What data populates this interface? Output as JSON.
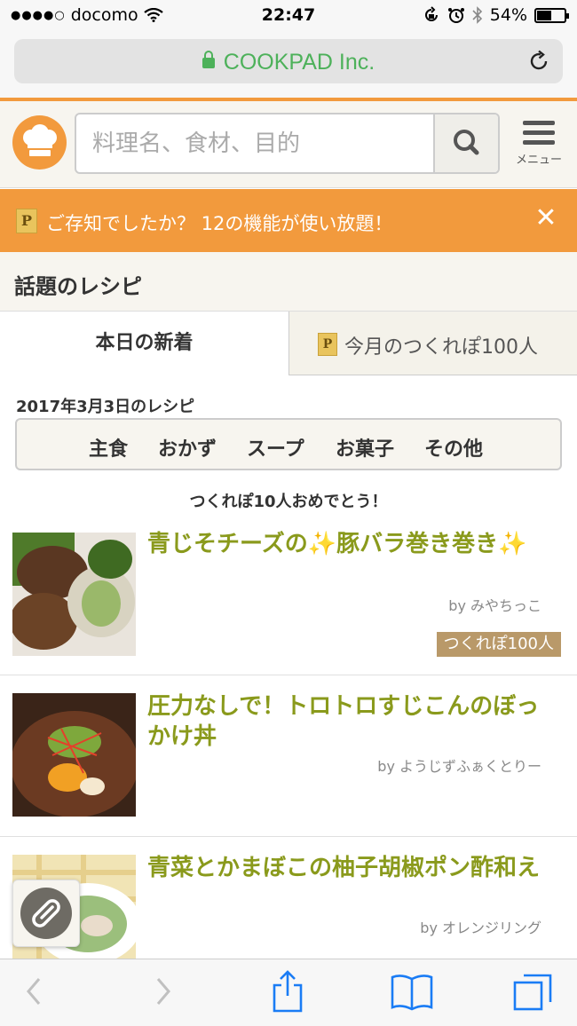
{
  "status_bar": {
    "signal": "●●●●○",
    "carrier": "docomo",
    "time": "22:47",
    "battery_percent": "54%",
    "battery_level": 0.54
  },
  "browser": {
    "url": "COOKPAD Inc."
  },
  "header": {
    "search_placeholder": "料理名、食材、目的",
    "menu_label": "メニュー"
  },
  "notice": {
    "badge": "P",
    "text": "ご存知でしたか？ 12の機能が使い放題！",
    "close": "✕"
  },
  "section": {
    "title": "話題のレシピ"
  },
  "tabs": [
    {
      "label": "本日の新着",
      "active": true
    },
    {
      "label": "今月のつくれぽ100人",
      "badge": "P",
      "active": false
    }
  ],
  "date_label": "2017年3月3日のレシピ",
  "categories": [
    "主食",
    "おかず",
    "スープ",
    "お菓子",
    "その他"
  ],
  "congrats": "つくれぽ10人おめでとう！",
  "recipes": [
    {
      "title": "青じそチーズの✨豚バラ巻き巻き✨",
      "author": "by みやちっこ",
      "badge": "つくれぽ100人"
    },
    {
      "title": "圧力なしで！トロトロすじこんのぼっかけ丼",
      "author": "by ようじずふぁくとりー"
    },
    {
      "title": "青菜とかまぼこの柚子胡椒ポン酢和え",
      "author": "by オレンジリング"
    }
  ],
  "colors": {
    "accent_orange": "#f29a3d",
    "recipe_title_green": "#8a9a1c",
    "url_green": "#4db15a",
    "ios_blue": "#1a7cf5"
  }
}
